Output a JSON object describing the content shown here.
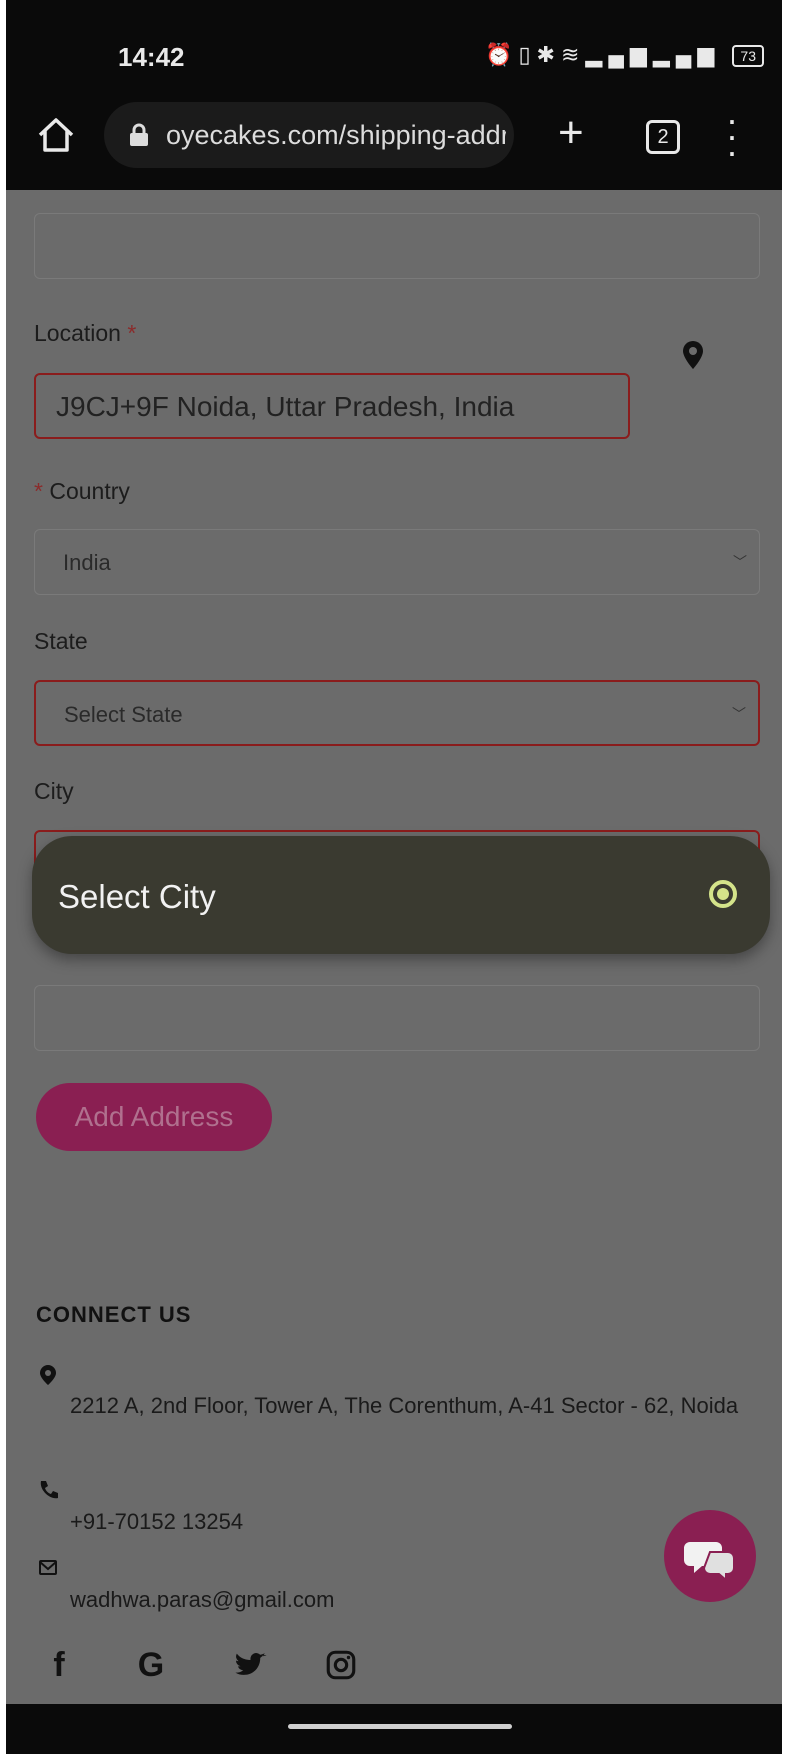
{
  "status_bar": {
    "time": "14:42",
    "battery": "73"
  },
  "browser": {
    "url": "oyecakes.com/shipping-addr",
    "tab_count": "2"
  },
  "form": {
    "location_label": "Location",
    "location_value": "J9CJ+9F Noida, Uttar Pradesh, India",
    "country_label": "Country",
    "country_value": "India",
    "state_label": "State",
    "state_value": "Select State",
    "city_label": "City",
    "required_mark": "*"
  },
  "popup": {
    "option_label": "Select City"
  },
  "actions": {
    "add_address_label": "Add Address"
  },
  "footer": {
    "heading": "CONNECT US",
    "address": "2212 A, 2nd Floor, Tower A, The Corenthum, A-41 Sector - 62, Noida",
    "phone": "+91-70152 13254",
    "email": "wadhwa.paras@gmail.com",
    "social": [
      "f",
      "G"
    ]
  },
  "colors": {
    "brand": "#8a1f52",
    "error_border": "#8a1c1c",
    "radio_accent": "#d4e38a"
  }
}
